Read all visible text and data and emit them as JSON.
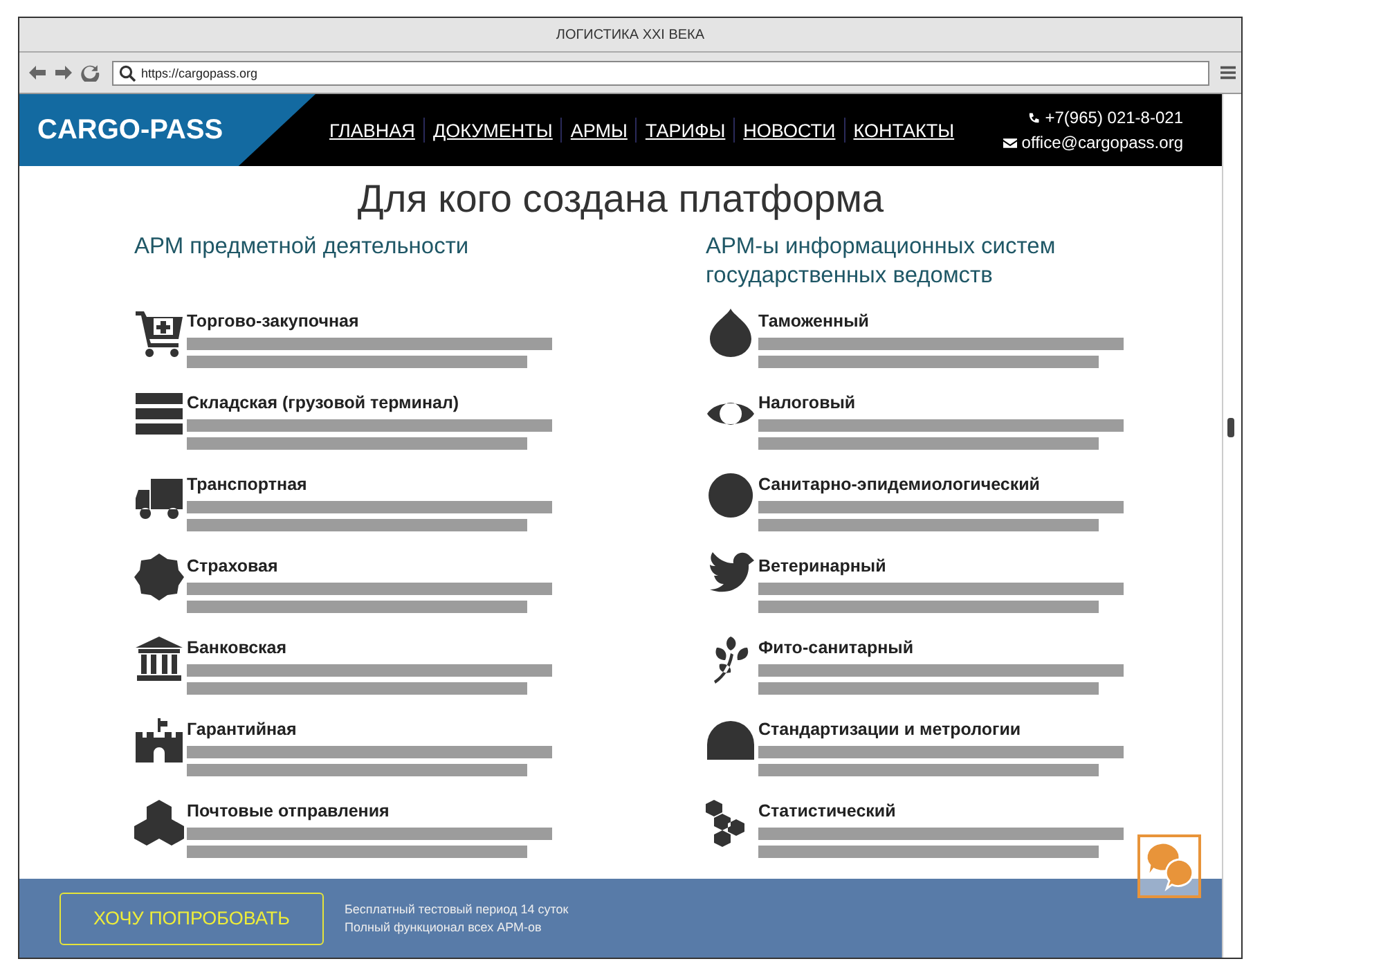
{
  "window": {
    "title": "ЛОГИСТИКА XXI ВЕКА"
  },
  "address_bar": {
    "url": "https://cargopass.org"
  },
  "header": {
    "logo": "CARGO-PASS",
    "nav": [
      {
        "label": "ГЛАВНАЯ"
      },
      {
        "label": "ДОКУМЕНТЫ"
      },
      {
        "label": "АРМЫ"
      },
      {
        "label": "ТАРИФЫ"
      },
      {
        "label": "НОВОСТИ"
      },
      {
        "label": "КОНТАКТЫ"
      }
    ],
    "phone": "+7(965) 021-8-021",
    "email": "office@cargopass.org"
  },
  "heading": "Для кого создана платформа",
  "columns": [
    {
      "title": "АРМ предметной деятельности",
      "items": [
        {
          "label": "Торгово-закупочная"
        },
        {
          "label": "Складская (грузовой терминал)"
        },
        {
          "label": "Транспортная"
        },
        {
          "label": "Страховая"
        },
        {
          "label": "Банковская"
        },
        {
          "label": "Гарантийная"
        },
        {
          "label": "Почтовые отправления"
        }
      ]
    },
    {
      "title": "АРМ-ы информационных систем государственных ведомств",
      "items": [
        {
          "label": "Таможенный"
        },
        {
          "label": "Налоговый"
        },
        {
          "label": "Санитарно-эпидемиологический"
        },
        {
          "label": "Ветеринарный"
        },
        {
          "label": "Фито-санитарный"
        },
        {
          "label": "Стандартизации и метрологии"
        },
        {
          "label": "Статистический"
        }
      ]
    }
  ],
  "footer": {
    "button": "ХОЧУ ПОПРОБОВАТЬ",
    "lines": [
      "Бесплатный тестовый период 14 суток",
      "Полный функционал всех АРМ-ов"
    ]
  }
}
